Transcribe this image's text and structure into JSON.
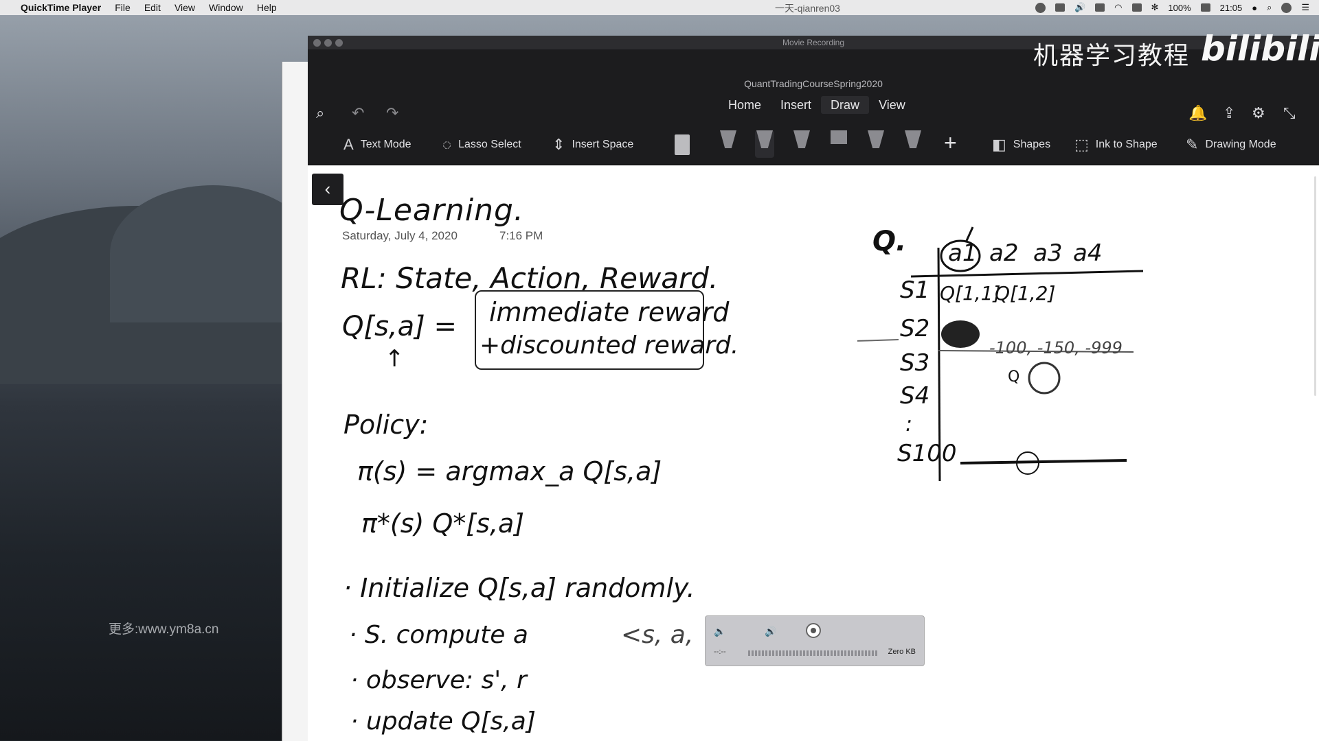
{
  "menubar": {
    "app_name": "QuickTime Player",
    "items": [
      "File",
      "Edit",
      "View",
      "Window",
      "Help"
    ],
    "center_title": "一天-qianren03",
    "battery": "100%",
    "clock": "21:05"
  },
  "desktop": {
    "watermark": "更多:www.ym8a.cn"
  },
  "window": {
    "recording_title": "Movie Recording",
    "doc_title": "QuantTradingCourseSpring2020",
    "tabs": [
      "Home",
      "Insert",
      "Draw",
      "View"
    ],
    "active_tab": "Draw",
    "ribbon": {
      "text_mode": "Text Mode",
      "lasso_select": "Lasso Select",
      "insert_space": "Insert Space",
      "shapes": "Shapes",
      "ink_to_shape": "Ink to Shape",
      "drawing_mode": "Drawing Mode"
    }
  },
  "page": {
    "title": "Q-Learning.",
    "date": "Saturday, July 4, 2020",
    "time": "7:16 PM",
    "ink": {
      "rl_line": "RL: State, Action, Reward.",
      "q_def_lhs": "Q[s,a] =",
      "q_def_box_1": "immediate reward",
      "q_def_box_2": "+discounted reward.",
      "policy": "Policy:",
      "pi_eq": "π(s) = argmax_a Q[s,a]",
      "pi_star": "π*(s)      Q*[s,a]",
      "init": "· Initialize Q[s,a] randomly.",
      "step_s": "· S.   compute a",
      "tuple": "<s, a,",
      "observe": "· observe: s', r",
      "update": "· update  Q[s,a]",
      "table_q": "Q.",
      "cols": [
        "a1",
        "a2",
        "a3",
        "a4"
      ],
      "rows": [
        "S1",
        "S2",
        "S3",
        "S4",
        ":",
        "S100"
      ],
      "cell_11": "Q[1,1]",
      "cell_12": "Q[1,2]",
      "row3_vals": "-100, -150, -999",
      "circled_q": "Q"
    }
  },
  "rec_widget": {
    "time": "--:--",
    "size": "Zero KB"
  },
  "overlay": {
    "cn_text": "机器学习教程",
    "logo_text": "bilibili"
  }
}
